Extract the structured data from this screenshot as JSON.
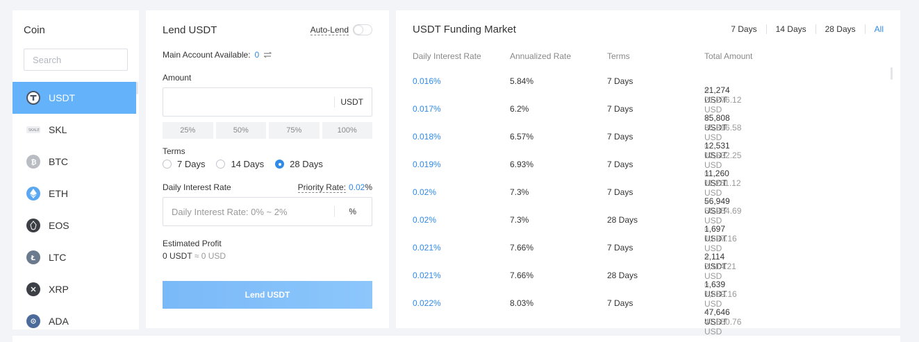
{
  "coin_panel": {
    "title": "Coin",
    "search_placeholder": "Search",
    "items": [
      {
        "label": "USDT",
        "icon": "usdt-icon",
        "active": true
      },
      {
        "label": "SKL",
        "icon": "skl-icon"
      },
      {
        "label": "BTC",
        "icon": "btc-icon"
      },
      {
        "label": "ETH",
        "icon": "eth-icon"
      },
      {
        "label": "EOS",
        "icon": "eos-icon"
      },
      {
        "label": "LTC",
        "icon": "ltc-icon"
      },
      {
        "label": "XRP",
        "icon": "xrp-icon"
      },
      {
        "label": "ADA",
        "icon": "ada-icon"
      }
    ]
  },
  "lend_panel": {
    "title": "Lend USDT",
    "auto_lend_label": "Auto-Lend",
    "available_label": "Main Account Available:",
    "available_value": "0",
    "amount_label": "Amount",
    "amount_value": "",
    "amount_unit": "USDT",
    "percent_options": [
      "25%",
      "50%",
      "75%",
      "100%"
    ],
    "terms_label": "Terms",
    "terms_options": [
      "7 Days",
      "14 Days",
      "28 Days"
    ],
    "terms_selected": "28 Days",
    "rate_label": "Daily Interest Rate",
    "priority_label": "Priority Rate:",
    "priority_value": "0.02",
    "priority_unit": "%",
    "rate_placeholder": "Daily Interest Rate: 0% ~ 2%",
    "rate_unit": "%",
    "estimated_label": "Estimated Profit",
    "estimated_value": "0 USDT",
    "estimated_usd": "≈ 0 USD",
    "submit_label": "Lend USDT"
  },
  "market_panel": {
    "title": "USDT Funding Market",
    "range_tabs": [
      "7 Days",
      "14 Days",
      "28 Days",
      "All"
    ],
    "range_selected": "All",
    "columns": [
      "Daily Interest Rate",
      "Annualized Rate",
      "Terms",
      "Total Amount"
    ],
    "rows": [
      {
        "rate": "0.016%",
        "annual": "5.84%",
        "terms": "7 Days",
        "amount": "21,274 USDT",
        "usd": "≈ 21,276.12 USD"
      },
      {
        "rate": "0.017%",
        "annual": "6.2%",
        "terms": "7 Days",
        "amount": "85,808 USDT",
        "usd": "≈ 85,816.58 USD"
      },
      {
        "rate": "0.018%",
        "annual": "6.57%",
        "terms": "7 Days",
        "amount": "12,531 USDT",
        "usd": "≈ 12,532.25 USD"
      },
      {
        "rate": "0.019%",
        "annual": "6.93%",
        "terms": "7 Days",
        "amount": "11,260 USDT",
        "usd": "≈ 11,261.12 USD"
      },
      {
        "rate": "0.02%",
        "annual": "7.3%",
        "terms": "7 Days",
        "amount": "56,949 USDT",
        "usd": "≈ 56,954.69 USD"
      },
      {
        "rate": "0.02%",
        "annual": "7.3%",
        "terms": "28 Days",
        "amount": "1,697 USDT",
        "usd": "≈ 1,697.16 USD"
      },
      {
        "rate": "0.021%",
        "annual": "7.66%",
        "terms": "7 Days",
        "amount": "2,114 USDT",
        "usd": "≈ 2,114.21 USD"
      },
      {
        "rate": "0.021%",
        "annual": "7.66%",
        "terms": "28 Days",
        "amount": "1,639 USDT",
        "usd": "≈ 1,639.16 USD"
      },
      {
        "rate": "0.022%",
        "annual": "8.03%",
        "terms": "7 Days",
        "amount": "47,646 USDT",
        "usd": "≈ 47,650.76 USD"
      }
    ]
  },
  "colors": {
    "accent": "#2f8ae8",
    "active_row": "#63b2fa",
    "button": "#7ab9f8"
  }
}
